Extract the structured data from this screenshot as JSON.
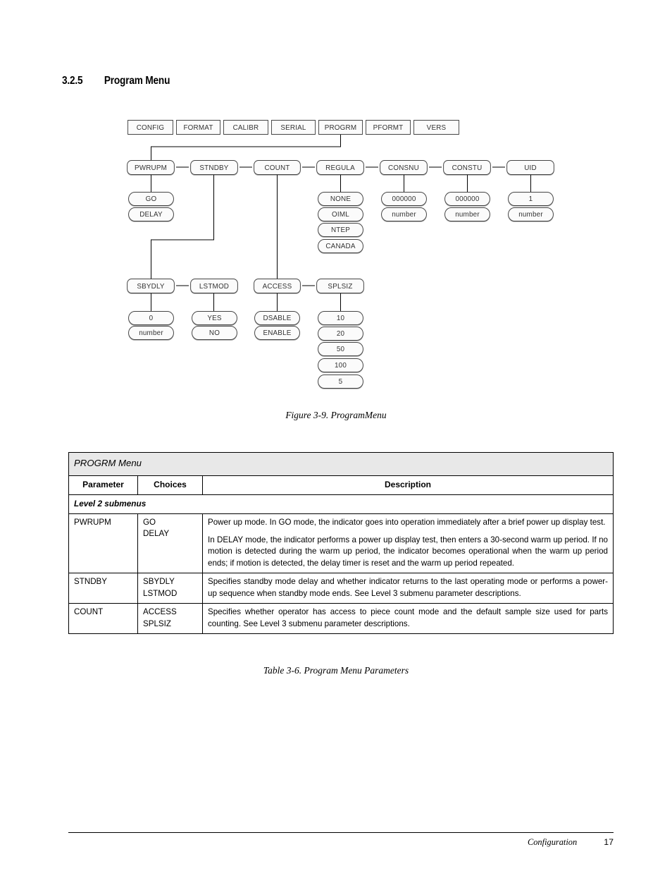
{
  "section": {
    "number": "3.2.5",
    "title": "Program Menu"
  },
  "figure": {
    "caption": "Figure 3-9. ProgramMenu",
    "top_menu": [
      {
        "label": "CONFIG"
      },
      {
        "label": "FORMAT"
      },
      {
        "label": "CALIBR"
      },
      {
        "label": "SERIAL"
      },
      {
        "label": "PROGRM"
      },
      {
        "label": "PFORMT"
      },
      {
        "label": "VERS"
      }
    ],
    "level2": [
      {
        "label": "PWRUPM"
      },
      {
        "label": "STNDBY"
      },
      {
        "label": "COUNT"
      },
      {
        "label": "REGULA"
      },
      {
        "label": "CONSNU"
      },
      {
        "label": "CONSTU"
      },
      {
        "label": "UID"
      }
    ],
    "pwrupm_options": [
      "GO",
      "DELAY"
    ],
    "regula_options": [
      "NONE",
      "OIML",
      "NTEP",
      "CANADA"
    ],
    "consnu_options": [
      "000000",
      "number"
    ],
    "constu_options": [
      "000000",
      "number"
    ],
    "uid_options": [
      "1",
      "number"
    ],
    "level3": [
      {
        "label": "SBYDLY"
      },
      {
        "label": "LSTMOD"
      },
      {
        "label": "ACCESS"
      },
      {
        "label": "SPLSIZ"
      }
    ],
    "sbydly_options": [
      "0",
      "number"
    ],
    "lstmod_options": [
      "YES",
      "NO"
    ],
    "access_options": [
      "DSABLE",
      "ENABLE"
    ],
    "splsiz_options": [
      "10",
      "20",
      "50",
      "100",
      "5"
    ]
  },
  "table": {
    "title": "PROGRM Menu",
    "caption": "Table 3-6. Program Menu Parameters",
    "headers": {
      "parameter": "Parameter",
      "choices": "Choices",
      "description": "Description"
    },
    "subheading": "Level 2 submenus",
    "rows": [
      {
        "parameter": "PWRUPM",
        "choices": [
          "GO",
          "DELAY"
        ],
        "paragraphs": [
          "Power up mode. In GO mode, the indicator goes into operation immediately after a brief power up display test.",
          "In DELAY mode, the indicator performs a power up display test, then enters a 30-second warm up period. If no motion is detected during the warm up period, the indicator becomes operational when the warm up period ends; if motion is detected, the delay timer is reset and the warm up period repeated."
        ]
      },
      {
        "parameter": "STNDBY",
        "choices": [
          "SBYDLY",
          "LSTMOD"
        ],
        "paragraphs": [
          "Specifies standby mode delay and whether indicator returns to the last operating mode or performs a power-up sequence when standby mode ends. See Level 3 submenu parameter descriptions."
        ]
      },
      {
        "parameter": "COUNT",
        "choices": [
          "ACCESS",
          "SPLSIZ"
        ],
        "paragraphs": [
          "Specifies whether operator has access to piece count mode and the default sample size used for parts counting. See Level 3 submenu parameter descriptions."
        ]
      }
    ]
  },
  "footer": {
    "label": "Configuration",
    "page": "17"
  }
}
